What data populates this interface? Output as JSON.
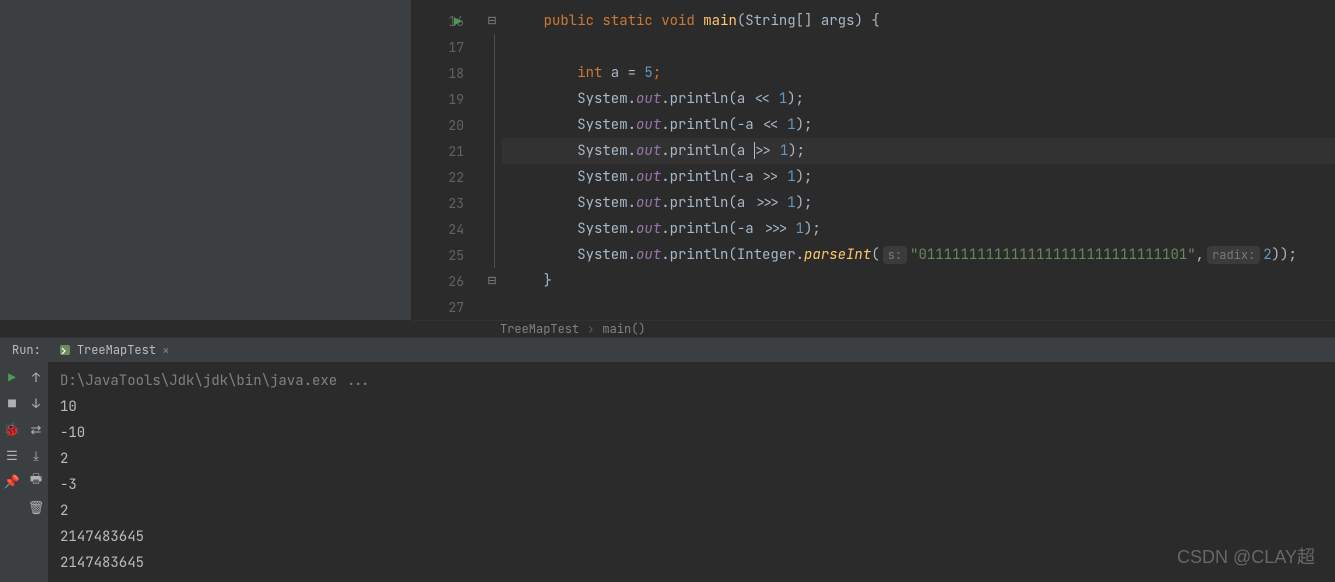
{
  "gutter": {
    "lines": [
      16,
      17,
      18,
      19,
      20,
      21,
      22,
      23,
      24,
      25,
      26,
      27
    ],
    "run_icon_line": 16,
    "highlighted_line": 21
  },
  "code": {
    "l16": {
      "pre": "    ",
      "kw1": "public",
      "sp1": " ",
      "kw2": "static",
      "sp2": " ",
      "kw3": "void",
      "sp3": " ",
      "m": "main",
      "args": "(String[] args) {"
    },
    "l17": "",
    "l18": {
      "pre": "        ",
      "kw": "int",
      "rest": " a = ",
      "num": "5",
      "semi": ";"
    },
    "l19": {
      "pre": "        ",
      "sys": "System.",
      "out": "out",
      "dot": ".println(a << ",
      "num": "1",
      "end": ");"
    },
    "l20": {
      "pre": "        ",
      "sys": "System.",
      "out": "out",
      "dot": ".println(-a << ",
      "num": "1",
      "end": ");"
    },
    "l21": {
      "pre": "        ",
      "sys": "System.",
      "out": "out",
      "dot": ".println(a ",
      "op": ">> ",
      "num": "1",
      "end": ");"
    },
    "l22": {
      "pre": "        ",
      "sys": "System.",
      "out": "out",
      "dot": ".println(-a >> ",
      "num": "1",
      "end": ");"
    },
    "l23": {
      "pre": "        ",
      "sys": "System.",
      "out": "out",
      "dot": ".println(a >>> ",
      "num": "1",
      "end": ");"
    },
    "l24": {
      "pre": "        ",
      "sys": "System.",
      "out": "out",
      "dot": ".println(-a >>> ",
      "num": "1",
      "end": ");"
    },
    "l25": {
      "pre": "        ",
      "sys": "System.",
      "out": "out",
      "dot": ".println(Integer.",
      "meth": "parseInt",
      "open": "(",
      "h1": "s:",
      "str": "\"01111111111111111111111111111101\"",
      "comma": ",",
      "h2": "radix:",
      "num": "2",
      "end": "));"
    },
    "l26": {
      "pre": "    }",
      "rest": ""
    },
    "l27": ""
  },
  "breadcrumb": {
    "a": "TreeMapTest",
    "b": "main()"
  },
  "run": {
    "label": "Run:",
    "tab": "TreeMapTest"
  },
  "console": {
    "cmd": "D:\\JavaTools\\Jdk\\jdk\\bin\\java.exe ...",
    "lines": [
      "10",
      "-10",
      "2",
      "-3",
      "2",
      "2147483645",
      "2147483645"
    ]
  },
  "watermark": "CSDN @CLAY超"
}
